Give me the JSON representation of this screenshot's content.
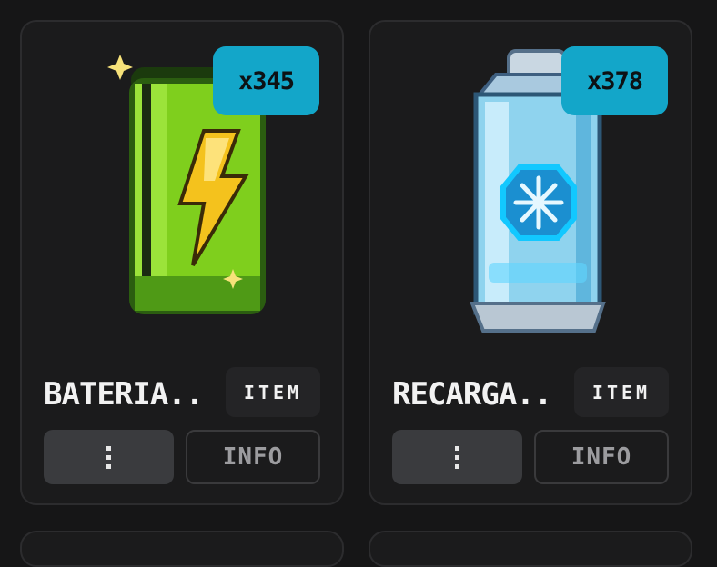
{
  "items": [
    {
      "name": "BATERIA...",
      "type_tag": "ITEM",
      "quantity": "x345",
      "menu_icon": "vertical-dots-icon",
      "info_label": "INFO",
      "art_icon": "green-battery-lightning-icon",
      "art_colors": {
        "body": "#7fcf1d",
        "dark": "#2b5d10",
        "bolt": "#f4c21d"
      }
    },
    {
      "name": "RECARGA...",
      "type_tag": "ITEM",
      "quantity": "x378",
      "menu_icon": "vertical-dots-icon",
      "info_label": "INFO",
      "art_icon": "blue-ice-canister-icon",
      "art_colors": {
        "body": "#8fd3ee",
        "glow": "#12c8ff",
        "cap": "#b9c7d3"
      }
    }
  ],
  "colors": {
    "badge": "#13a6c9",
    "card": "#1b1b1c",
    "button": "#3a3b3e"
  }
}
